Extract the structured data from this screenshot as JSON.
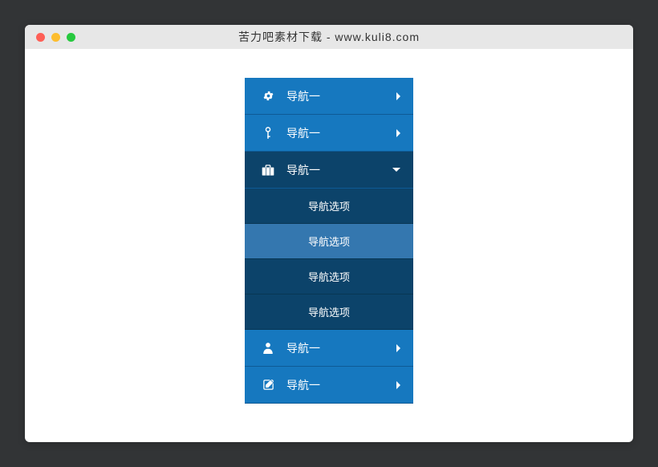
{
  "window": {
    "title": "苦力吧素材下载 - www.kuli8.com"
  },
  "nav": {
    "items": [
      {
        "label": "导航一",
        "icon": "gear",
        "expanded": false
      },
      {
        "label": "导航一",
        "icon": "key",
        "expanded": false
      },
      {
        "label": "导航一",
        "icon": "briefcase",
        "expanded": true,
        "sub": [
          {
            "label": "导航选项",
            "hover": false
          },
          {
            "label": "导航选项",
            "hover": true
          },
          {
            "label": "导航选项",
            "hover": false
          },
          {
            "label": "导航选项",
            "hover": false
          }
        ]
      },
      {
        "label": "导航一",
        "icon": "user",
        "expanded": false
      },
      {
        "label": "导航一",
        "icon": "edit",
        "expanded": false
      }
    ]
  },
  "colors": {
    "navBg": "#1678bf",
    "navExpandedBg": "#0c436a",
    "navHoverBg": "#3477af"
  }
}
